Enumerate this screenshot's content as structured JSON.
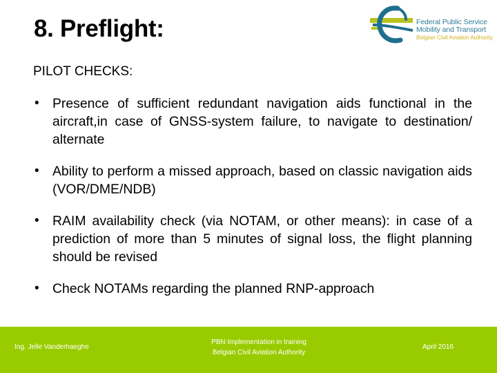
{
  "slide": {
    "title": "8. Preflight:",
    "subheading": "PILOT CHECKS:",
    "bullet_glyph": "•",
    "bullets": [
      "Presence of sufficient redundant navigation aids functional in the aircraft,in case of GNSS-system failure, to navigate to destination/ alternate",
      "Ability to perform a missed approach, based on classic navigation aids (VOR/DME/NDB)",
      "RAIM availability check (via NOTAM, or other means): in case of a prediction of more than 5 minutes of signal loss, the flight planning should be revised",
      "Check NOTAMs regarding the planned RNP-approach"
    ]
  },
  "logo": {
    "icon": "federal-public-service-logo-icon",
    "line1": "Federal Public Service",
    "line2": "Mobility and Transport",
    "line3": "Belgian Civil Aviation Authority",
    "colors": {
      "blue": "#1f6f8f",
      "olive": "#b9c21f",
      "gold": "#d4b21e"
    }
  },
  "footer": {
    "author": "Ing. Jelle Vanderhaeghe",
    "center_line1": "PBN Implementation in training",
    "center_line2": "Belgian Civil Aviation Authority",
    "date": "April 2016",
    "background": "#99cc00"
  }
}
